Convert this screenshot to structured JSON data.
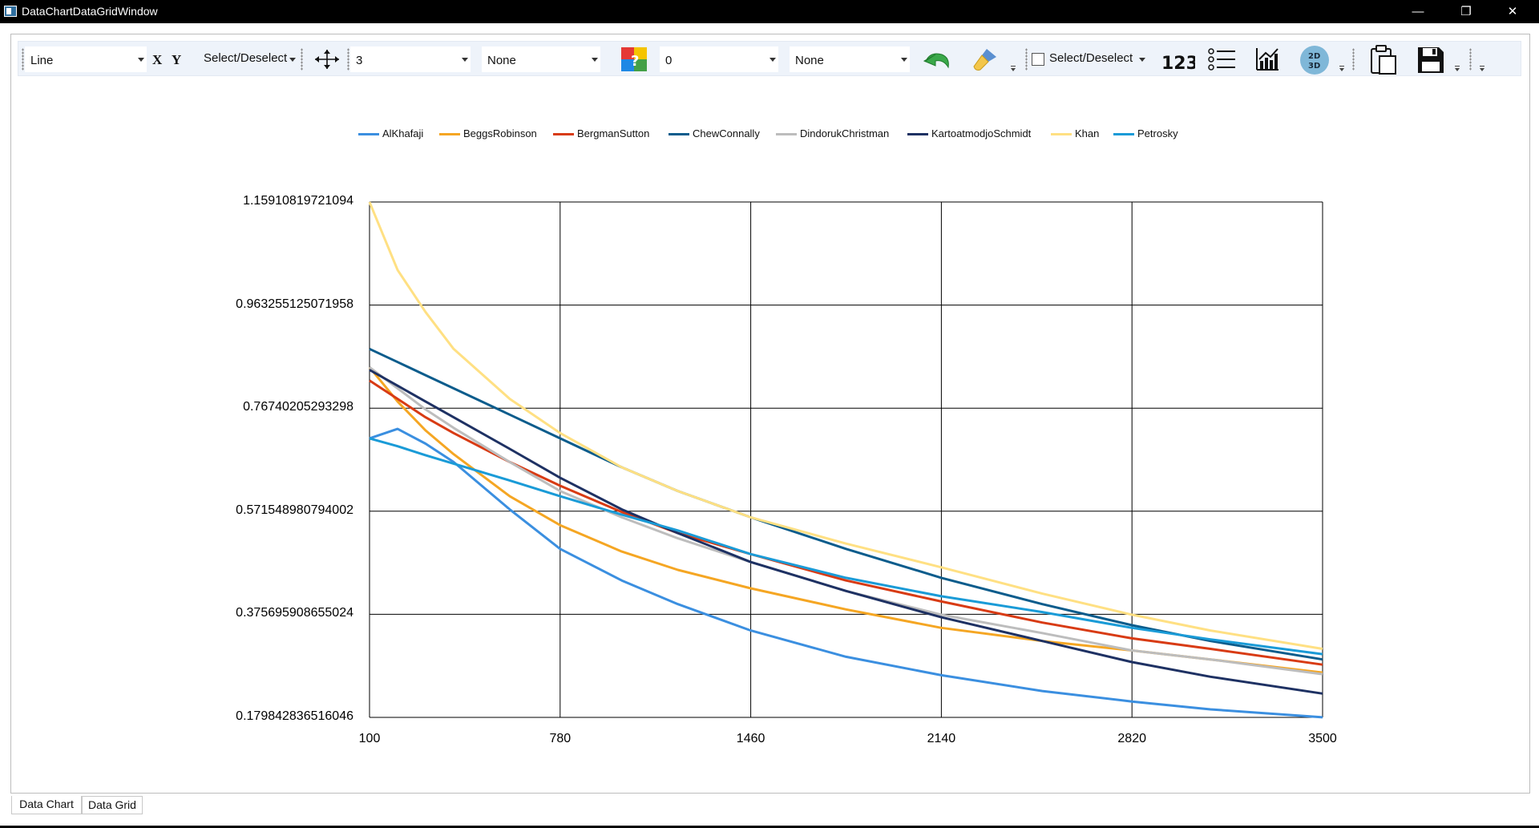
{
  "window": {
    "title": "DataChartDataGridWindow",
    "minimize": "—",
    "maximize": "❐",
    "close": "✕"
  },
  "toolbar": {
    "chart_type": "Line",
    "x_icon": "X",
    "y_icon": "Y",
    "select_deselect_1": "Select/Deselect",
    "line_width": "3",
    "marker_style": "None",
    "value_combo": "0",
    "palette": "None",
    "select_deselect_2": "Select/Deselect",
    "values_icon_label": "123",
    "toggle_2d3d_label_top": "2D",
    "toggle_2d3d_label_bottom": "3D"
  },
  "tabs": {
    "data_chart": "Data Chart",
    "data_grid": "Data Grid"
  },
  "chart_data": {
    "type": "line",
    "title": "",
    "xlabel": "",
    "ylabel": "",
    "xlim": [
      100,
      3500
    ],
    "ylim": [
      0.179842836516046,
      1.15910819721094
    ],
    "grid": true,
    "legend_position": "top",
    "x_ticks": [
      "100",
      "780",
      "1460",
      "2140",
      "2820",
      "3500"
    ],
    "y_ticks": [
      "1.15910819721094",
      "0.963255125071958",
      "0.76740205293298",
      "0.571548980794002",
      "0.375695908655024",
      "0.179842836516046"
    ],
    "x": [
      100,
      200,
      300,
      400,
      600,
      780,
      1000,
      1200,
      1460,
      1800,
      2140,
      2500,
      2820,
      3100,
      3500
    ],
    "series": [
      {
        "name": "AlKhafaji",
        "color": "#3b8fe0",
        "values": [
          0.71,
          0.728,
          0.7,
          0.665,
          0.575,
          0.5,
          0.44,
          0.395,
          0.345,
          0.295,
          0.26,
          0.23,
          0.21,
          0.195,
          0.18
        ]
      },
      {
        "name": "BeggsRobinson",
        "color": "#f5a623",
        "values": [
          0.845,
          0.78,
          0.725,
          0.68,
          0.6,
          0.545,
          0.495,
          0.46,
          0.425,
          0.385,
          0.35,
          0.325,
          0.307,
          0.29,
          0.265
        ]
      },
      {
        "name": "BergmanSutton",
        "color": "#d83b14",
        "values": [
          0.82,
          0.785,
          0.75,
          0.72,
          0.665,
          0.62,
          0.57,
          0.53,
          0.49,
          0.44,
          0.4,
          0.36,
          0.33,
          0.31,
          0.28
        ]
      },
      {
        "name": "ChewConnally",
        "color": "#0b5c8c",
        "values": [
          0.88,
          0.855,
          0.83,
          0.805,
          0.755,
          0.71,
          0.655,
          0.61,
          0.56,
          0.5,
          0.445,
          0.395,
          0.355,
          0.325,
          0.29
        ]
      },
      {
        "name": "DindorukChristman",
        "color": "#bdbdbd",
        "values": [
          0.845,
          0.805,
          0.765,
          0.73,
          0.665,
          0.61,
          0.56,
          0.52,
          0.475,
          0.42,
          0.375,
          0.34,
          0.307,
          0.29,
          0.262
        ]
      },
      {
        "name": "KartoatmodjoSchmidt",
        "color": "#1e3163",
        "values": [
          0.84,
          0.81,
          0.78,
          0.75,
          0.69,
          0.635,
          0.575,
          0.53,
          0.475,
          0.42,
          0.37,
          0.325,
          0.285,
          0.257,
          0.225
        ]
      },
      {
        "name": "Khan",
        "color": "#ffe083",
        "values": [
          1.159,
          1.03,
          0.95,
          0.88,
          0.785,
          0.72,
          0.655,
          0.61,
          0.56,
          0.51,
          0.465,
          0.415,
          0.375,
          0.345,
          0.31
        ]
      },
      {
        "name": "Petrosky",
        "color": "#1a9bd7",
        "values": [
          0.71,
          0.695,
          0.678,
          0.662,
          0.63,
          0.6,
          0.565,
          0.535,
          0.49,
          0.445,
          0.41,
          0.38,
          0.35,
          0.328,
          0.3
        ]
      }
    ]
  }
}
